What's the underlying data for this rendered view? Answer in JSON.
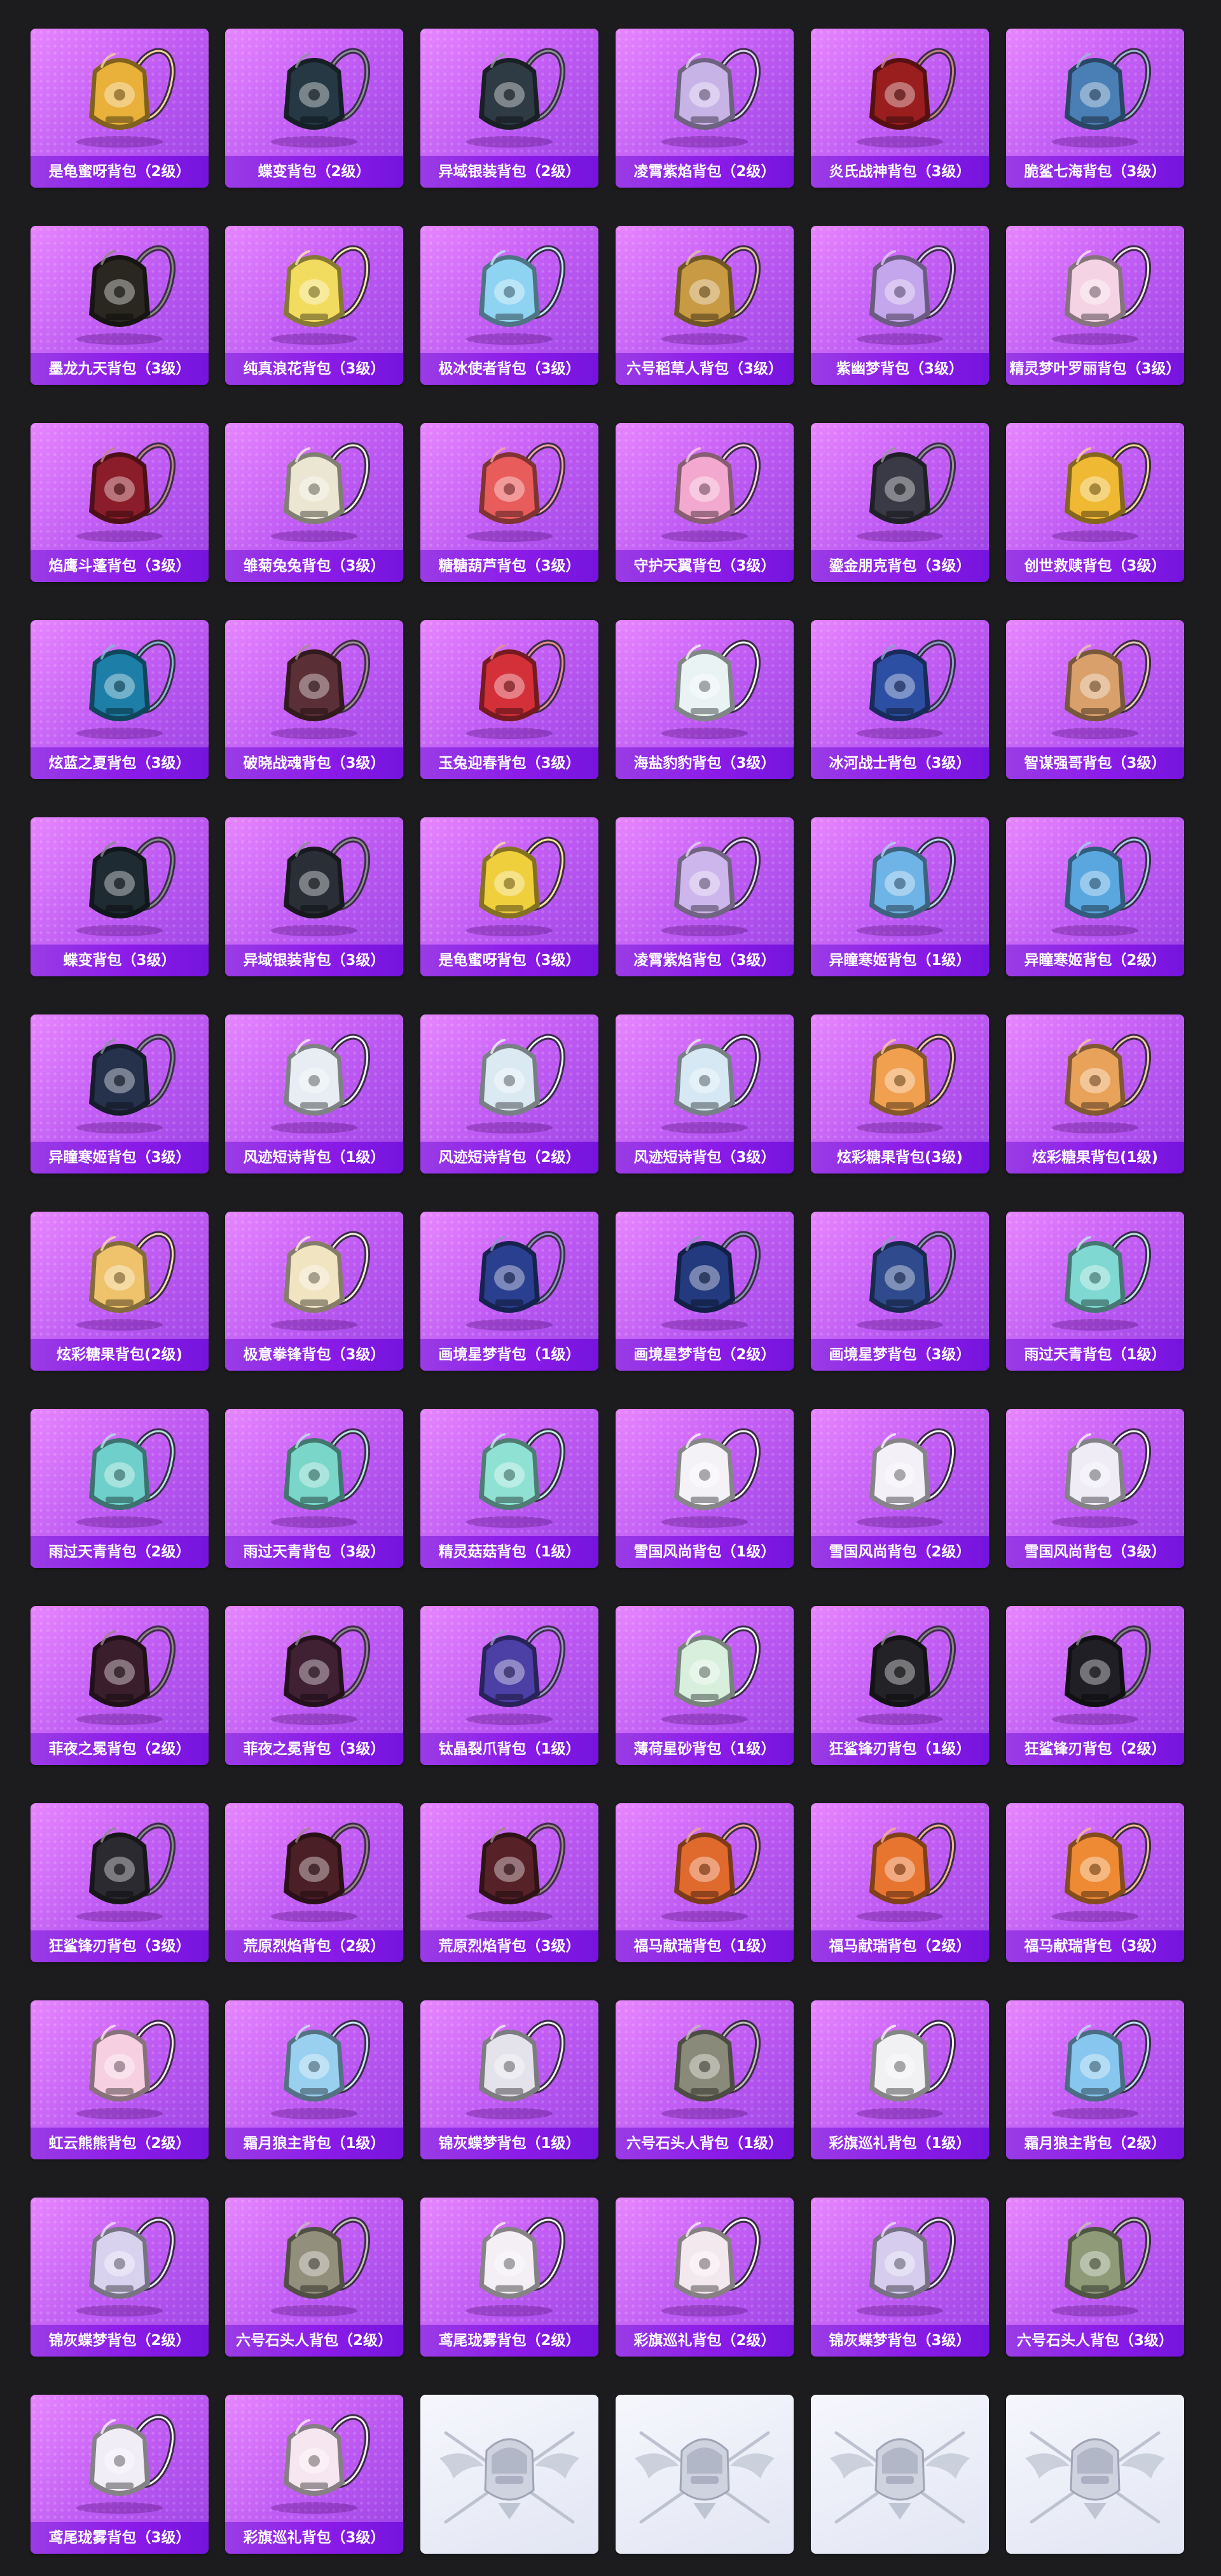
{
  "items": [
    {
      "label": "是龟蜜呀背包（2级）",
      "icon": "golden-sphere-backpack-icon",
      "color": "#e9b13a"
    },
    {
      "label": "蝶变背包（2级）",
      "icon": "dark-butterfly-backpack-icon",
      "color": "#263844"
    },
    {
      "label": "异域银装背包（2级）",
      "icon": "silver-armor-backpack-icon",
      "color": "#2e3a44"
    },
    {
      "label": "凌霄紫焰背包（2级）",
      "icon": "violet-crest-backpack-icon",
      "color": "#c7b3e6"
    },
    {
      "label": "炎氏战神背包（3级）",
      "icon": "flame-warrior-backpack-icon",
      "color": "#9a1e1e"
    },
    {
      "label": "脆鲨七海背包（3级）",
      "icon": "shark-backpack-icon",
      "color": "#4a7fb5"
    },
    {
      "label": "墨龙九天背包（3级）",
      "icon": "dragon-backpack-icon",
      "color": "#2a2620"
    },
    {
      "label": "纯真浪花背包（3级）",
      "icon": "wave-cup-backpack-icon",
      "color": "#f2dc5f"
    },
    {
      "label": "极冰使者背包（3级）",
      "icon": "ice-crystal-backpack-icon",
      "color": "#8fd3f2"
    },
    {
      "label": "六号稻草人背包（3级）",
      "icon": "scarecrow-backpack-icon",
      "color": "#c79a43"
    },
    {
      "label": "紫幽梦背包（3级）",
      "icon": "purple-dream-backpack-icon",
      "color": "#c3a6ec"
    },
    {
      "label": "精灵梦叶罗丽背包（3级）",
      "icon": "fairy-heart-backpack-icon",
      "color": "#f4d3e4"
    },
    {
      "label": "焰鹰斗蓬背包（3级）",
      "icon": "red-hawk-backpack-icon",
      "color": "#8b1d2a"
    },
    {
      "label": "雏菊兔兔背包（3级）",
      "icon": "daisy-bunny-backpack-icon",
      "color": "#eae6d2"
    },
    {
      "label": "糖糖葫芦背包（3级）",
      "icon": "candy-gourd-backpack-icon",
      "color": "#e95c5c"
    },
    {
      "label": "守护天翼背包（3级）",
      "icon": "guardian-wing-backpack-icon",
      "color": "#f3a9cf"
    },
    {
      "label": "鎏金朋克背包（3级）",
      "icon": "gold-punk-backpack-icon",
      "color": "#3a3a46"
    },
    {
      "label": "创世救赎背包（3级）",
      "icon": "genesis-backpack-icon",
      "color": "#f0b933"
    },
    {
      "label": "炫蓝之夏背包（3级）",
      "icon": "blue-summer-backpack-icon",
      "color": "#1d7fa7"
    },
    {
      "label": "破晓战魂背包（3级）",
      "icon": "dawn-spirit-backpack-icon",
      "color": "#5a3036"
    },
    {
      "label": "玉兔迎春背包（3级）",
      "icon": "jade-rabbit-backpack-icon",
      "color": "#d3303a"
    },
    {
      "label": "海盐豹豹背包（3级）",
      "icon": "sea-salt-leopard-backpack-icon",
      "color": "#e9f3f4"
    },
    {
      "label": "冰河战士背包（3级）",
      "icon": "glacier-warrior-backpack-icon",
      "color": "#2d4fa3"
    },
    {
      "label": "智谋强哥背包（3级）",
      "icon": "wise-bear-backpack-icon",
      "color": "#d9a06b"
    },
    {
      "label": "蝶变背包（3级）",
      "icon": "dark-butterfly-backpack-icon",
      "color": "#1f2b33"
    },
    {
      "label": "异域银装背包（3级）",
      "icon": "silver-armor-backpack-icon",
      "color": "#2a2e36"
    },
    {
      "label": "是龟蜜呀背包（3级）",
      "icon": "golden-sphere-backpack-icon",
      "color": "#f0cf3d"
    },
    {
      "label": "凌霄紫焰背包（3级）",
      "icon": "violet-crest-backpack-icon",
      "color": "#cdb6ec"
    },
    {
      "label": "异瞳寒姬背包（1级）",
      "icon": "frost-maiden-backpack-icon",
      "color": "#6fb4e6"
    },
    {
      "label": "异瞳寒姬背包（2级）",
      "icon": "frost-maiden-backpack-icon",
      "color": "#5aa7e0"
    },
    {
      "label": "异瞳寒姬背包（3级）",
      "icon": "frost-maiden-backpack-icon",
      "color": "#26324c"
    },
    {
      "label": "风迹短诗背包（1级）",
      "icon": "wind-poem-backpack-icon",
      "color": "#e7edf2"
    },
    {
      "label": "风迹短诗背包（2级）",
      "icon": "wind-poem-backpack-icon",
      "color": "#dbe9f3"
    },
    {
      "label": "风迹短诗背包（3级）",
      "icon": "wind-poem-backpack-icon",
      "color": "#d6e8f3"
    },
    {
      "label": "炫彩糖果背包(3级)",
      "icon": "donut-backpack-icon",
      "color": "#f0a04f"
    },
    {
      "label": "炫彩糖果背包(1级)",
      "icon": "donut-backpack-icon",
      "color": "#e9a25a"
    },
    {
      "label": "炫彩糖果背包(2级)",
      "icon": "donut-backpack-icon",
      "color": "#efc36c"
    },
    {
      "label": "极意拳锋背包（3级）",
      "icon": "fist-cloud-backpack-icon",
      "color": "#f1e4c1"
    },
    {
      "label": "画境星梦背包（1级）",
      "icon": "star-book-backpack-icon",
      "color": "#2a3f8f"
    },
    {
      "label": "画境星梦背包（2级）",
      "icon": "star-book-backpack-icon",
      "color": "#233a7e"
    },
    {
      "label": "画境星梦背包（3级）",
      "icon": "star-book-backpack-icon",
      "color": "#2f4b8d"
    },
    {
      "label": "雨过天青背包（1级）",
      "icon": "sky-blue-backpack-icon",
      "color": "#7fd8d1"
    },
    {
      "label": "雨过天青背包（2级）",
      "icon": "sky-blue-backpack-icon",
      "color": "#6fd0cb"
    },
    {
      "label": "雨过天青背包（3级）",
      "icon": "sky-blue-backpack-icon",
      "color": "#79d6c9"
    },
    {
      "label": "精灵菇菇背包（1级）",
      "icon": "mushroom-backpack-icon",
      "color": "#8fe1d3"
    },
    {
      "label": "雪国风尚背包（1级）",
      "icon": "snow-bunny-backpack-icon",
      "color": "#f4f2f7"
    },
    {
      "label": "雪国风尚背包（2级）",
      "icon": "snow-bunny-backpack-icon",
      "color": "#f3f0f7"
    },
    {
      "label": "雪国风尚背包（3级）",
      "icon": "snow-bunny-backpack-icon",
      "color": "#efecf6"
    },
    {
      "label": "菲夜之冕背包（2级）",
      "icon": "night-crown-backpack-icon",
      "color": "#3b1e2c"
    },
    {
      "label": "菲夜之冕背包（3级）",
      "icon": "night-crown-backpack-icon",
      "color": "#402033"
    },
    {
      "label": "钛晶裂爪背包（1级）",
      "icon": "crystal-claw-backpack-icon",
      "color": "#4c3fa6"
    },
    {
      "label": "薄荷星砂背包（1级）",
      "icon": "mint-sand-backpack-icon",
      "color": "#d8efde"
    },
    {
      "label": "狂鲨锋刃背包（1级）",
      "icon": "shark-blade-backpack-icon",
      "color": "#222227"
    },
    {
      "label": "狂鲨锋刃背包（2级）",
      "icon": "shark-blade-backpack-icon",
      "color": "#1f1f25"
    },
    {
      "label": "狂鲨锋刃背包（3级）",
      "icon": "shark-blade-backpack-icon",
      "color": "#2a2a30"
    },
    {
      "label": "荒原烈焰背包（2级）",
      "icon": "wasteland-flame-backpack-icon",
      "color": "#4a1f26"
    },
    {
      "label": "荒原烈焰背包（3级）",
      "icon": "wasteland-flame-backpack-icon",
      "color": "#562228"
    },
    {
      "label": "福马献瑞背包（1级）",
      "icon": "lucky-horse-backpack-icon",
      "color": "#e0692d"
    },
    {
      "label": "福马献瑞背包（2级）",
      "icon": "lucky-horse-backpack-icon",
      "color": "#e7752f"
    },
    {
      "label": "福马献瑞背包（3级）",
      "icon": "lucky-horse-backpack-icon",
      "color": "#ee8a34"
    },
    {
      "label": "虹云熊熊背包（2级）",
      "icon": "rainbow-bear-backpack-icon",
      "color": "#f6cfe1"
    },
    {
      "label": "霜月狼主背包（1级）",
      "icon": "frost-wolf-backpack-icon",
      "color": "#9ad0ef"
    },
    {
      "label": "锦灰蝶梦背包（1级）",
      "icon": "ash-butterfly-backpack-icon",
      "color": "#e4e2ea"
    },
    {
      "label": "六号石头人背包（1级）",
      "icon": "stone-man-backpack-icon",
      "color": "#8a8a7a"
    },
    {
      "label": "彩旗巡礼背包（1级）",
      "icon": "flag-parade-backpack-icon",
      "color": "#f1f1f4"
    },
    {
      "label": "霜月狼主背包（2级）",
      "icon": "frost-wolf-backpack-icon",
      "color": "#86c6ef"
    },
    {
      "label": "锦灰蝶梦背包（2级）",
      "icon": "ash-butterfly-backpack-icon",
      "color": "#d9d2ef"
    },
    {
      "label": "六号石头人背包（2级）",
      "icon": "stone-man-backpack-icon",
      "color": "#92907c"
    },
    {
      "label": "鸢尾珑雾背包（2级）",
      "icon": "iris-mist-backpack-icon",
      "color": "#f3eff5"
    },
    {
      "label": "彩旗巡礼背包（2级）",
      "icon": "flag-parade-backpack-icon",
      "color": "#f4e8ef"
    },
    {
      "label": "锦灰蝶梦背包（3级）",
      "icon": "ash-butterfly-backpack-icon",
      "color": "#d6cdee"
    },
    {
      "label": "六号石头人背包（3级）",
      "icon": "stone-man-backpack-icon",
      "color": "#8f9a79"
    },
    {
      "label": "鸢尾珑雾背包（3级）",
      "icon": "iris-mist-backpack-icon",
      "color": "#f1edf6"
    },
    {
      "label": "彩旗巡礼背包（3级）",
      "icon": "flag-parade-backpack-icon",
      "color": "#f5e6ef"
    }
  ],
  "placeholders": [
    {
      "icon": "pubg-emblem-icon"
    },
    {
      "icon": "pubg-emblem-icon"
    },
    {
      "icon": "pubg-emblem-icon"
    },
    {
      "icon": "pubg-emblem-icon"
    }
  ]
}
